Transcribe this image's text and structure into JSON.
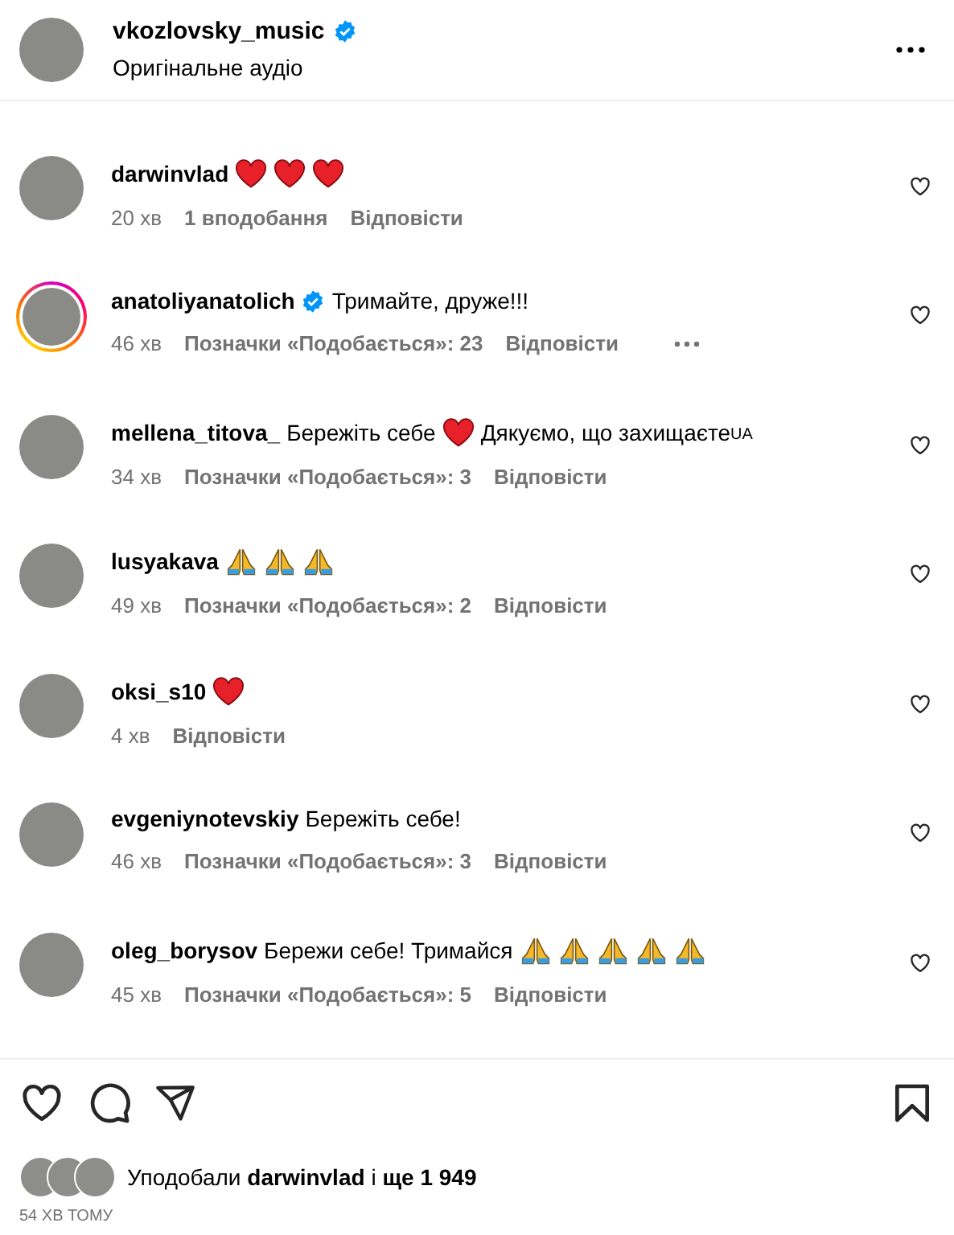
{
  "header": {
    "username": "vkozlovsky_music",
    "verified": true,
    "subtitle": "Оригінальне аудіо"
  },
  "comments": [
    {
      "username": "darwinvlad",
      "verified": false,
      "story": false,
      "body": [
        {
          "kind": "heart"
        },
        {
          "kind": "heart"
        },
        {
          "kind": "heart"
        }
      ],
      "time": "20 хв",
      "likes": "1 вподобання",
      "reply": "Відповісти",
      "more": false
    },
    {
      "username": "anatoliyanatolich",
      "verified": true,
      "story": true,
      "body": [
        {
          "kind": "text",
          "text": "Тримайте, друже!!!"
        }
      ],
      "time": "46 хв",
      "likes": "Позначки «Подобається»: 23",
      "reply": "Відповісти",
      "more": true
    },
    {
      "username": "mellena_titova_",
      "verified": false,
      "story": false,
      "body": [
        {
          "kind": "text",
          "text": "Бережіть себе"
        },
        {
          "kind": "heart"
        },
        {
          "kind": "text",
          "text": "Дякуємо, що захищаєте"
        },
        {
          "kind": "small",
          "text": "UA"
        }
      ],
      "time": "34 хв",
      "likes": "Позначки «Подобається»: 3",
      "reply": "Відповісти",
      "more": false
    },
    {
      "username": "lusyakava",
      "verified": false,
      "story": false,
      "body": [
        {
          "kind": "pray"
        },
        {
          "kind": "pray"
        },
        {
          "kind": "pray"
        }
      ],
      "time": "49 хв",
      "likes": "Позначки «Подобається»: 2",
      "reply": "Відповісти",
      "more": false
    },
    {
      "username": "oksi_s10",
      "verified": false,
      "story": false,
      "body": [
        {
          "kind": "heart"
        }
      ],
      "time": "4 хв",
      "reply": "Відповісти",
      "more": false
    },
    {
      "username": "evgeniynotevskiy",
      "verified": false,
      "story": false,
      "body": [
        {
          "kind": "text",
          "text": "Бережіть себе!"
        }
      ],
      "time": "46 хв",
      "likes": "Позначки «Подобається»: 3",
      "reply": "Відповісти",
      "more": false
    },
    {
      "username": "oleg_borysov",
      "verified": false,
      "story": false,
      "body": [
        {
          "kind": "text",
          "text": "Бережи себе! Тримайся"
        },
        {
          "kind": "pray"
        },
        {
          "kind": "pray"
        },
        {
          "kind": "pray"
        },
        {
          "kind": "pray"
        },
        {
          "kind": "pray"
        }
      ],
      "time": "45 хв",
      "likes": "Позначки «Подобається»: 5",
      "reply": "Відповісти",
      "more": false
    }
  ],
  "liked_by": {
    "prefix": "Уподобали",
    "user": "darwinvlad",
    "suffix": "і ще 1 949"
  },
  "timestamp": "54 ХВ ТОМУ"
}
